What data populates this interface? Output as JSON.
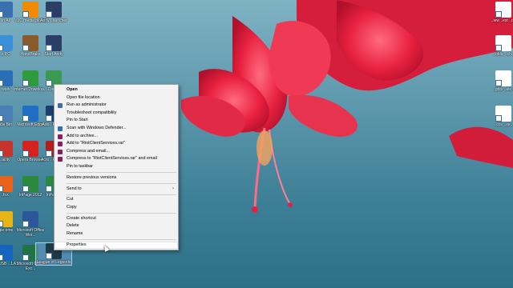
{
  "desktop": {
    "left_icons": [
      {
        "label": "..in All",
        "color": "#3a6fb0"
      },
      {
        "label": "VLC media player",
        "color": "#f08a00"
      },
      {
        "label": "Andy Launcher",
        "color": "#2c3e66"
      },
      {
        "label": "..s PC",
        "color": "#3b8fd6"
      },
      {
        "label": "HandBrake",
        "color": "#8a5a2b"
      },
      {
        "label": "Start Andy",
        "color": "#2c3e66"
      },
      {
        "label": "..work",
        "color": "#2a6fb6"
      },
      {
        "label": "Internet Downloa...",
        "color": "#2e9b3d"
      },
      {
        "label": "Camt..",
        "color": "#3a9a50"
      },
      {
        "label": "..cle Bin",
        "color": "#4a7fb5"
      },
      {
        "label": "Microsoft Edge",
        "color": "#1f6fc5"
      },
      {
        "label": "Ado.. Photo..",
        "color": "#1b3e6e"
      },
      {
        "label": "..acity",
        "color": "#c7342c"
      },
      {
        "label": "Opera Browser",
        "color": "#d6211f"
      },
      {
        "label": "Acro.. Reade..",
        "color": "#b71c1c"
      },
      {
        "label": "..fox",
        "color": "#e8641b"
      },
      {
        "label": "InPage 2012",
        "color": "#2a8a3c"
      },
      {
        "label": "InPage..",
        "color": "#2a8a3c"
      },
      {
        "label": "..gle ome",
        "color": "#e7b416"
      },
      {
        "label": "Microsoft Office Wor...",
        "color": "#2b579a"
      },
      {
        "label": "..eK USB ...LA...",
        "color": "#1565c0"
      },
      {
        "label": "Microsoft Office Exc...",
        "color": "#217346"
      },
      {
        "label": "League of Legends",
        "color": "#1e3b45"
      }
    ],
    "right_icons": [
      {
        "label": "..iew ..ext ..oc",
        "color": "#ffffff"
      },
      {
        "label": "..oldic ..ch..",
        "color": "#ffffff"
      },
      {
        "label": "..ghts ..ele..",
        "color": "#ffffff"
      },
      {
        "label": "..cce ..xe..",
        "color": "#ffffff"
      }
    ]
  },
  "context_menu": {
    "items": [
      {
        "type": "item",
        "label": "Open",
        "bold": true
      },
      {
        "type": "item",
        "label": "Open file location"
      },
      {
        "type": "item",
        "label": "Run as administrator",
        "icon": "shield-icon",
        "icon_color": "#3a6ea5"
      },
      {
        "type": "item",
        "label": "Troubleshoot compatibility"
      },
      {
        "type": "item",
        "label": "Pin to Start"
      },
      {
        "type": "item",
        "label": "Scan with Windows Defender...",
        "icon": "defender-icon",
        "icon_color": "#2b6fb7"
      },
      {
        "type": "item",
        "label": "Add to archive...",
        "icon": "archive-icon",
        "icon_color": "#8b1f5e"
      },
      {
        "type": "item",
        "label": "Add to \"RiotClientServices.rar\"",
        "icon": "archive-icon",
        "icon_color": "#8b1f5e"
      },
      {
        "type": "item",
        "label": "Compress and email...",
        "icon": "archive-icon",
        "icon_color": "#8b1f5e"
      },
      {
        "type": "item",
        "label": "Compress to \"RiotClientServices.rar\" and email",
        "icon": "archive-icon",
        "icon_color": "#8b1f5e"
      },
      {
        "type": "item",
        "label": "Pin to taskbar"
      },
      {
        "type": "separator"
      },
      {
        "type": "item",
        "label": "Restore previous versions"
      },
      {
        "type": "separator"
      },
      {
        "type": "item",
        "label": "Send to",
        "submenu": true
      },
      {
        "type": "separator"
      },
      {
        "type": "item",
        "label": "Cut"
      },
      {
        "type": "item",
        "label": "Copy"
      },
      {
        "type": "separator"
      },
      {
        "type": "item",
        "label": "Create shortcut"
      },
      {
        "type": "item",
        "label": "Delete"
      },
      {
        "type": "item",
        "label": "Rename"
      },
      {
        "type": "separator"
      },
      {
        "type": "item",
        "label": "Properties",
        "hover": true
      }
    ],
    "submenu_arrow": "›"
  }
}
